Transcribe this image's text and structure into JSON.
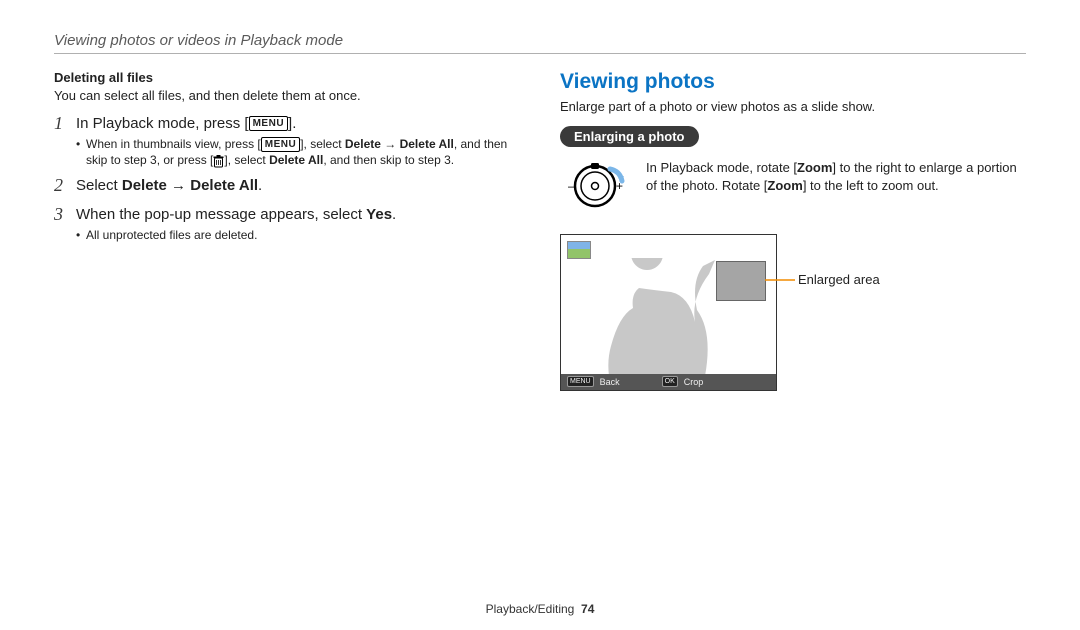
{
  "header": {
    "title": "Viewing photos or videos in Playback mode"
  },
  "left": {
    "sub_title": "Deleting all files",
    "sub_text": "You can select all files, and then delete them at once.",
    "steps": {
      "s1_pre": "In Playback mode, press [",
      "s1_post": "].",
      "s1b_pre": "When in thumbnails view, press [",
      "s1b_mid1": "], select ",
      "s1b_b1": "Delete",
      "s1b_arrow": " → ",
      "s1b_b2": "Delete All",
      "s1b_mid2": ", and then skip to step 3, or press [",
      "s1b_mid3": "], select ",
      "s1b_b3": "Delete All",
      "s1b_end": ", and then skip to step 3.",
      "s2_pre": "Select ",
      "s2_b1": "Delete",
      "s2_arrow": " → ",
      "s2_b2": "Delete All",
      "s2_post": ".",
      "s3_pre": "When the pop-up message appears, select ",
      "s3_b": "Yes",
      "s3_post": ".",
      "s3_bullet": "All unprotected files are deleted."
    },
    "menu_label": "MENU"
  },
  "right": {
    "section_title": "Viewing photos",
    "intro": "Enlarge part of a photo or view photos as a slide show.",
    "pill": "Enlarging a photo",
    "zoom_pre": "In Playback mode, rotate [",
    "zoom_b1": "Zoom",
    "zoom_mid": "] to the right to enlarge a portion of the photo. Rotate [",
    "zoom_b2": "Zoom",
    "zoom_post": "] to the left to zoom out.",
    "screen": {
      "back_badge": "MENU",
      "back_label": "Back",
      "ok_badge": "OK",
      "crop_label": "Crop"
    },
    "callout": "Enlarged area"
  },
  "footer": {
    "section": "Playback/Editing",
    "page": "74"
  }
}
